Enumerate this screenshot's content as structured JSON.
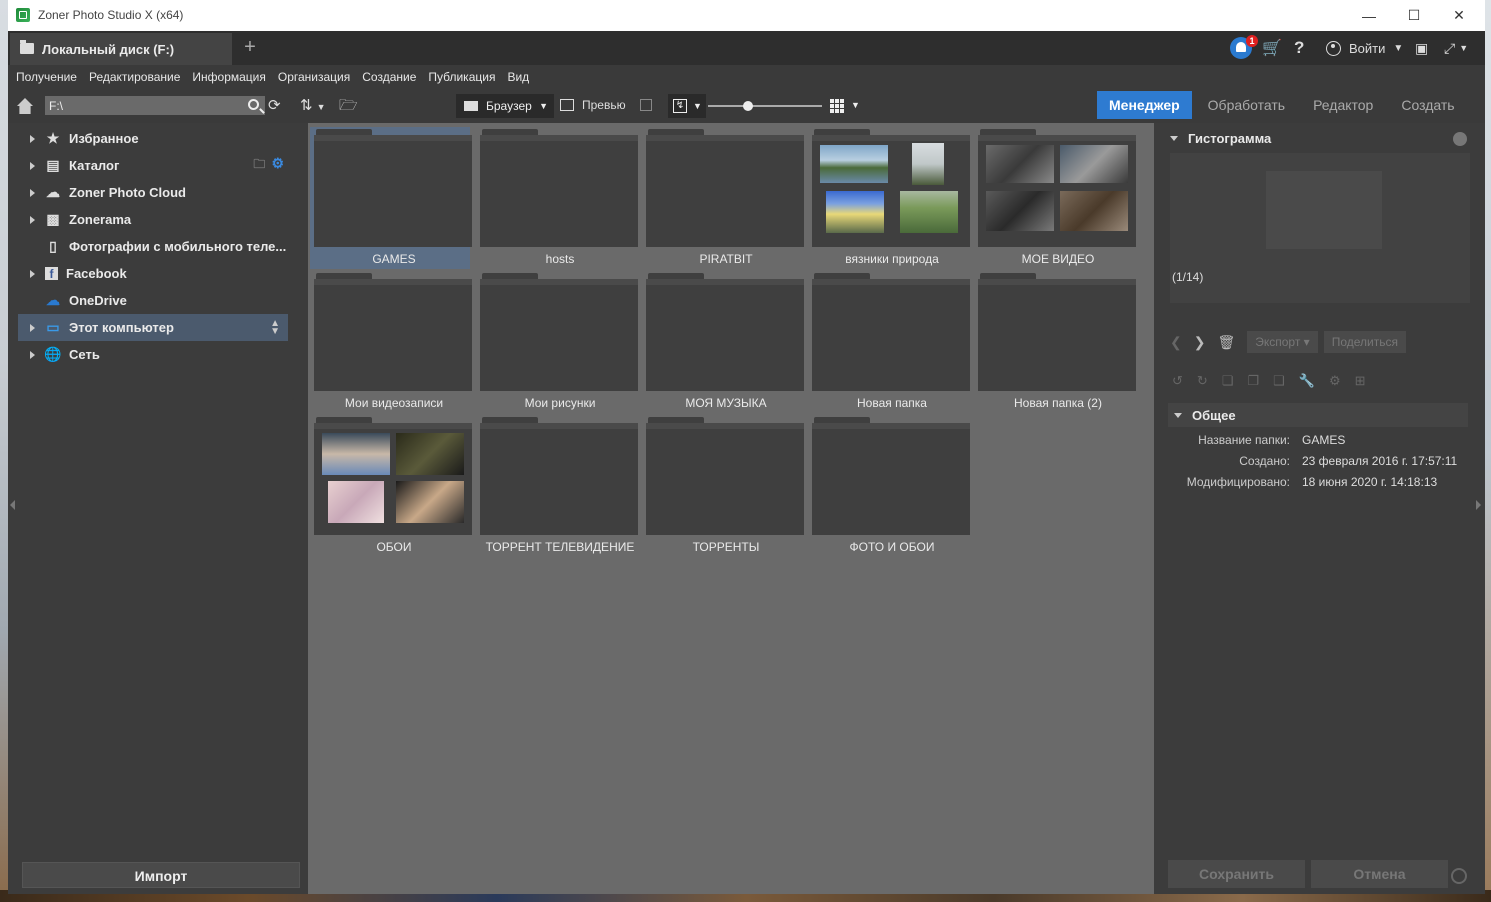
{
  "window": {
    "title": "Zoner Photo Studio X (x64)"
  },
  "tab": {
    "label": "Локальный диск (F:)"
  },
  "header": {
    "notification_count": "1",
    "login_label": "Войти"
  },
  "menu": [
    "Получение",
    "Редактирование",
    "Информация",
    "Организация",
    "Создание",
    "Публикация",
    "Вид"
  ],
  "toolbar": {
    "path": "F:\\",
    "view_mode": "Браузер",
    "preview_label": "Превью",
    "zoom_level": 0.35
  },
  "modes": [
    "Менеджер",
    "Обработать",
    "Редактор",
    "Создать"
  ],
  "active_mode": "Менеджер",
  "navigator": [
    {
      "label": "Избранное",
      "icon": "star-icon",
      "arrow": true
    },
    {
      "label": "Каталог",
      "icon": "catalog-icon",
      "arrow": true
    },
    {
      "label": "Zoner Photo Cloud",
      "icon": "cloud-icon",
      "arrow": true
    },
    {
      "label": "Zonerama",
      "icon": "zonerama-icon",
      "arrow": true
    },
    {
      "label": "Фотографии с мобильного теле...",
      "icon": "phone-icon",
      "arrow": false
    },
    {
      "label": "Facebook",
      "icon": "facebook-icon",
      "arrow": true
    },
    {
      "label": "OneDrive",
      "icon": "onedrive-icon",
      "arrow": false
    },
    {
      "label": "Этот компьютер",
      "icon": "computer-icon",
      "arrow": true,
      "selected": true
    },
    {
      "label": "Сеть",
      "icon": "network-icon",
      "arrow": true
    }
  ],
  "import_label": "Импорт",
  "folders": [
    {
      "name": "GAMES",
      "selected": true
    },
    {
      "name": "hosts"
    },
    {
      "name": "PIRATBIT"
    },
    {
      "name": "вязники природа",
      "thumbs": true
    },
    {
      "name": "МОЕ ВИДЕО",
      "thumbs": true
    },
    {
      "name": "Мои видеозаписи"
    },
    {
      "name": "Мои рисунки"
    },
    {
      "name": "МОЯ МУЗЫКА"
    },
    {
      "name": "Новая папка"
    },
    {
      "name": "Новая папка (2)"
    },
    {
      "name": "ОБОИ",
      "thumbs": true
    },
    {
      "name": "ТОРРЕНТ ТЕЛЕВИДЕНИЕ"
    },
    {
      "name": "ТОРРЕНТЫ"
    },
    {
      "name": "ФОТО И ОБОИ"
    }
  ],
  "right": {
    "histogram_title": "Гистограмма",
    "counter": "(1/14)",
    "export_label": "Экспорт",
    "share_label": "Поделиться",
    "general_title": "Общее",
    "properties": [
      {
        "label": "Название папки:",
        "value": "GAMES"
      },
      {
        "label": "Создано:",
        "value": "23 февраля 2016 г. 17:57:11"
      },
      {
        "label": "Модифицировано:",
        "value": "18 июня 2020 г. 14:18:13"
      }
    ],
    "save_label": "Сохранить",
    "cancel_label": "Отмена"
  },
  "colors": {
    "accent": "#2e7bd1",
    "selection": "#4b5a6d",
    "folder_selected": "#5b6e86"
  }
}
